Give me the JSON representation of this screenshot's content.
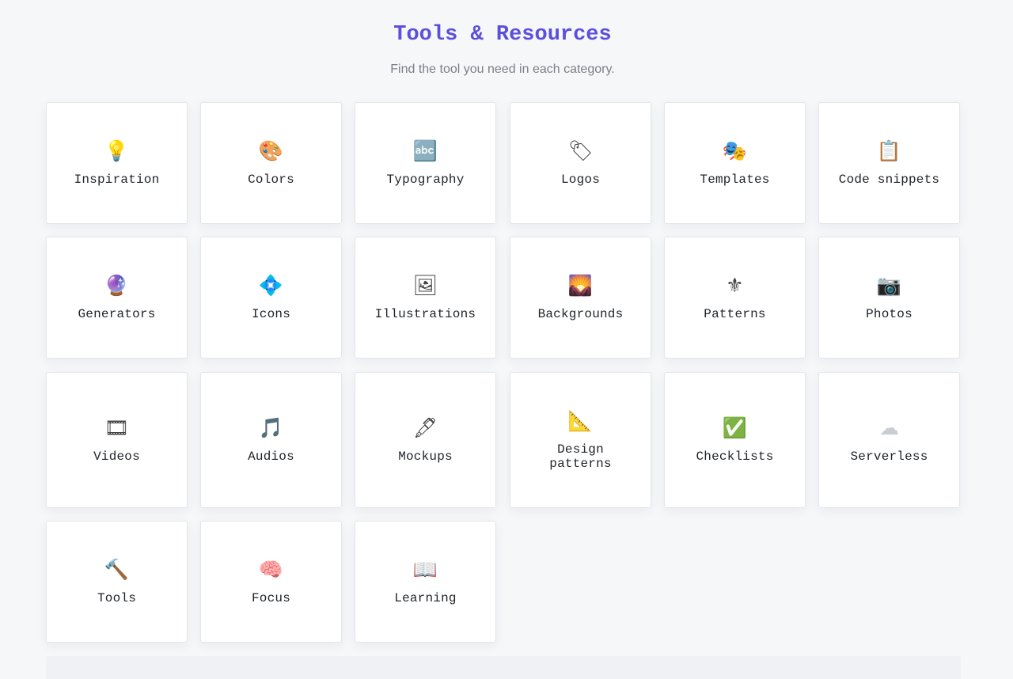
{
  "header": {
    "title": "Tools & Resources",
    "subtitle": "Find the tool you need in each category."
  },
  "categories": [
    {
      "label": "Inspiration",
      "icon": "💡",
      "icon_name": "lightbulb-icon"
    },
    {
      "label": "Colors",
      "icon": "🎨",
      "icon_name": "palette-icon"
    },
    {
      "label": "Typography",
      "icon": "🔤",
      "icon_name": "abc-icon"
    },
    {
      "label": "Logos",
      "icon": "🏷",
      "icon_name": "tag-icon"
    },
    {
      "label": "Templates",
      "icon": "🎭",
      "icon_name": "theater-masks-icon"
    },
    {
      "label": "Code snippets",
      "icon": "📋",
      "icon_name": "clipboard-icon"
    },
    {
      "label": "Generators",
      "icon": "🔮",
      "icon_name": "crystal-ball-icon"
    },
    {
      "label": "Icons",
      "icon": "💠",
      "icon_name": "diamond-shape-icon"
    },
    {
      "label": "Illustrations",
      "icon": "🖼",
      "icon_name": "framed-picture-icon"
    },
    {
      "label": "Backgrounds",
      "icon": "🌄",
      "icon_name": "sunrise-mountains-icon"
    },
    {
      "label": "Patterns",
      "icon": "⚜",
      "icon_name": "fleur-de-lis-icon"
    },
    {
      "label": "Photos",
      "icon": "📷",
      "icon_name": "camera-icon"
    },
    {
      "label": "Videos",
      "icon": "🎞",
      "icon_name": "film-frames-icon"
    },
    {
      "label": "Audios",
      "icon": "🎵",
      "icon_name": "music-note-icon"
    },
    {
      "label": "Mockups",
      "icon": "🖋",
      "icon_name": "fountain-pen-icon"
    },
    {
      "label": "Design patterns",
      "icon": "📐",
      "icon_name": "triangle-ruler-icon"
    },
    {
      "label": "Checklists",
      "icon": "✅",
      "icon_name": "check-mark-icon"
    },
    {
      "label": "Serverless",
      "icon": "☁",
      "icon_name": "cloud-icon"
    },
    {
      "label": "Tools",
      "icon": "🔨",
      "icon_name": "hammer-icon"
    },
    {
      "label": "Focus",
      "icon": "🧠",
      "icon_name": "brain-icon"
    },
    {
      "label": "Learning",
      "icon": "📖",
      "icon_name": "open-book-icon"
    }
  ],
  "colors": {
    "accent": "#5b4fdb",
    "subtitle": "#7b7f87",
    "background": "#f6f7f9",
    "card": "#ffffff"
  }
}
